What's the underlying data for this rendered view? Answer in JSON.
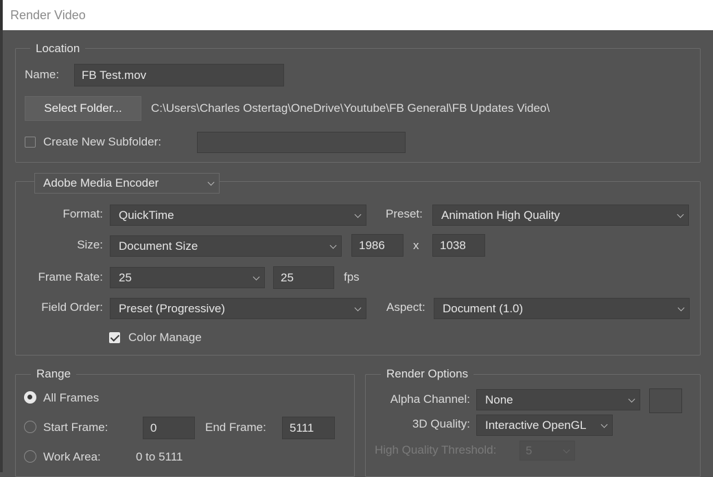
{
  "window": {
    "title": "Render Video"
  },
  "location": {
    "legend": "Location",
    "name_label": "Name:",
    "name_value": "FB Test.mov",
    "select_folder_label": "Select Folder...",
    "folder_path": "C:\\Users\\Charles Ostertag\\OneDrive\\Youtube\\FB General\\FB Updates Video\\",
    "create_subfolder_label": "Create New Subfolder:",
    "create_subfolder_checked": false,
    "subfolder_value": ""
  },
  "encoder": {
    "selector_value": "Adobe Media Encoder",
    "format_label": "Format:",
    "format_value": "QuickTime",
    "preset_label": "Preset:",
    "preset_value": "Animation High Quality",
    "size_label": "Size:",
    "size_value": "Document Size",
    "width_value": "1986",
    "x_label": "x",
    "height_value": "1038",
    "frame_rate_label": "Frame Rate:",
    "frame_rate_value": "25",
    "fps_value": "25",
    "fps_label": "fps",
    "field_order_label": "Field Order:",
    "field_order_value": "Preset (Progressive)",
    "aspect_label": "Aspect:",
    "aspect_value": "Document (1.0)",
    "color_manage_label": "Color Manage",
    "color_manage_checked": true
  },
  "range": {
    "legend": "Range",
    "all_frames_label": "All Frames",
    "start_frame_label": "Start Frame:",
    "start_frame_value": "0",
    "end_frame_label": "End Frame:",
    "end_frame_value": "5111",
    "work_area_label": "Work Area:",
    "work_area_value": "0 to 5111",
    "selected": "all_frames"
  },
  "render_options": {
    "legend": "Render Options",
    "alpha_label": "Alpha Channel:",
    "alpha_value": "None",
    "quality_label": "3D Quality:",
    "quality_value": "Interactive OpenGL",
    "hq_threshold_label": "High Quality Threshold:",
    "hq_threshold_value": "5"
  }
}
